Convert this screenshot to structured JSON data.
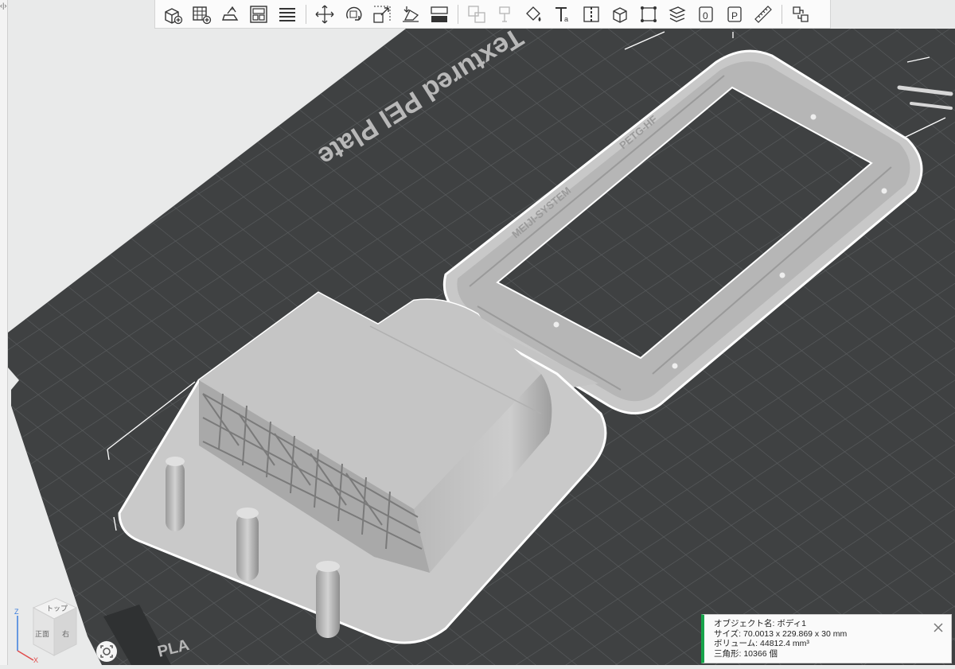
{
  "toolbar": {
    "tools": [
      {
        "icon": "add-object-icon"
      },
      {
        "icon": "add-plate-icon"
      },
      {
        "icon": "auto-orient-icon"
      },
      {
        "icon": "arrange-icon"
      },
      {
        "icon": "layers-icon"
      },
      {
        "icon": "move-icon"
      },
      {
        "icon": "rotate-icon"
      },
      {
        "icon": "scale-icon"
      },
      {
        "icon": "lay-on-face-icon"
      },
      {
        "icon": "cut-icon"
      },
      {
        "icon": "boolean-icon"
      },
      {
        "icon": "support-paint-icon"
      },
      {
        "icon": "color-paint-icon"
      },
      {
        "icon": "text-icon"
      },
      {
        "icon": "seam-icon"
      },
      {
        "icon": "measure-box-icon"
      },
      {
        "icon": "fit-icon"
      },
      {
        "icon": "variable-layer-icon"
      },
      {
        "icon": "brim-ear-icon"
      },
      {
        "icon": "assembly-icon"
      },
      {
        "icon": "ruler-icon"
      },
      {
        "icon": "split-parts-icon"
      }
    ]
  },
  "bed": {
    "label": "Textured PEI Plate",
    "filament_label": "PLA",
    "colors": {
      "plate": "#3f4142",
      "grid": "#5b5e60",
      "model": "#c9c9c9",
      "outline": "#ffffff"
    }
  },
  "model": {
    "engravings": [
      "MEIJI-SYSTEM",
      "PETG-HF"
    ]
  },
  "view_cube": {
    "top": "トップ",
    "front": "正面",
    "right": "右",
    "axis_z": "Z",
    "axis_x": "X"
  },
  "info": {
    "object_name_label": "オブジェクト名: ボディ1",
    "size_label": "サイズ: 70.0013 x 229.869 x 30 mm",
    "volume_label": "ボリューム: 44812.4 mm³",
    "triangles_label": "三角形: 10366 個"
  },
  "left_edge": {
    "collapse": "‹|›"
  }
}
